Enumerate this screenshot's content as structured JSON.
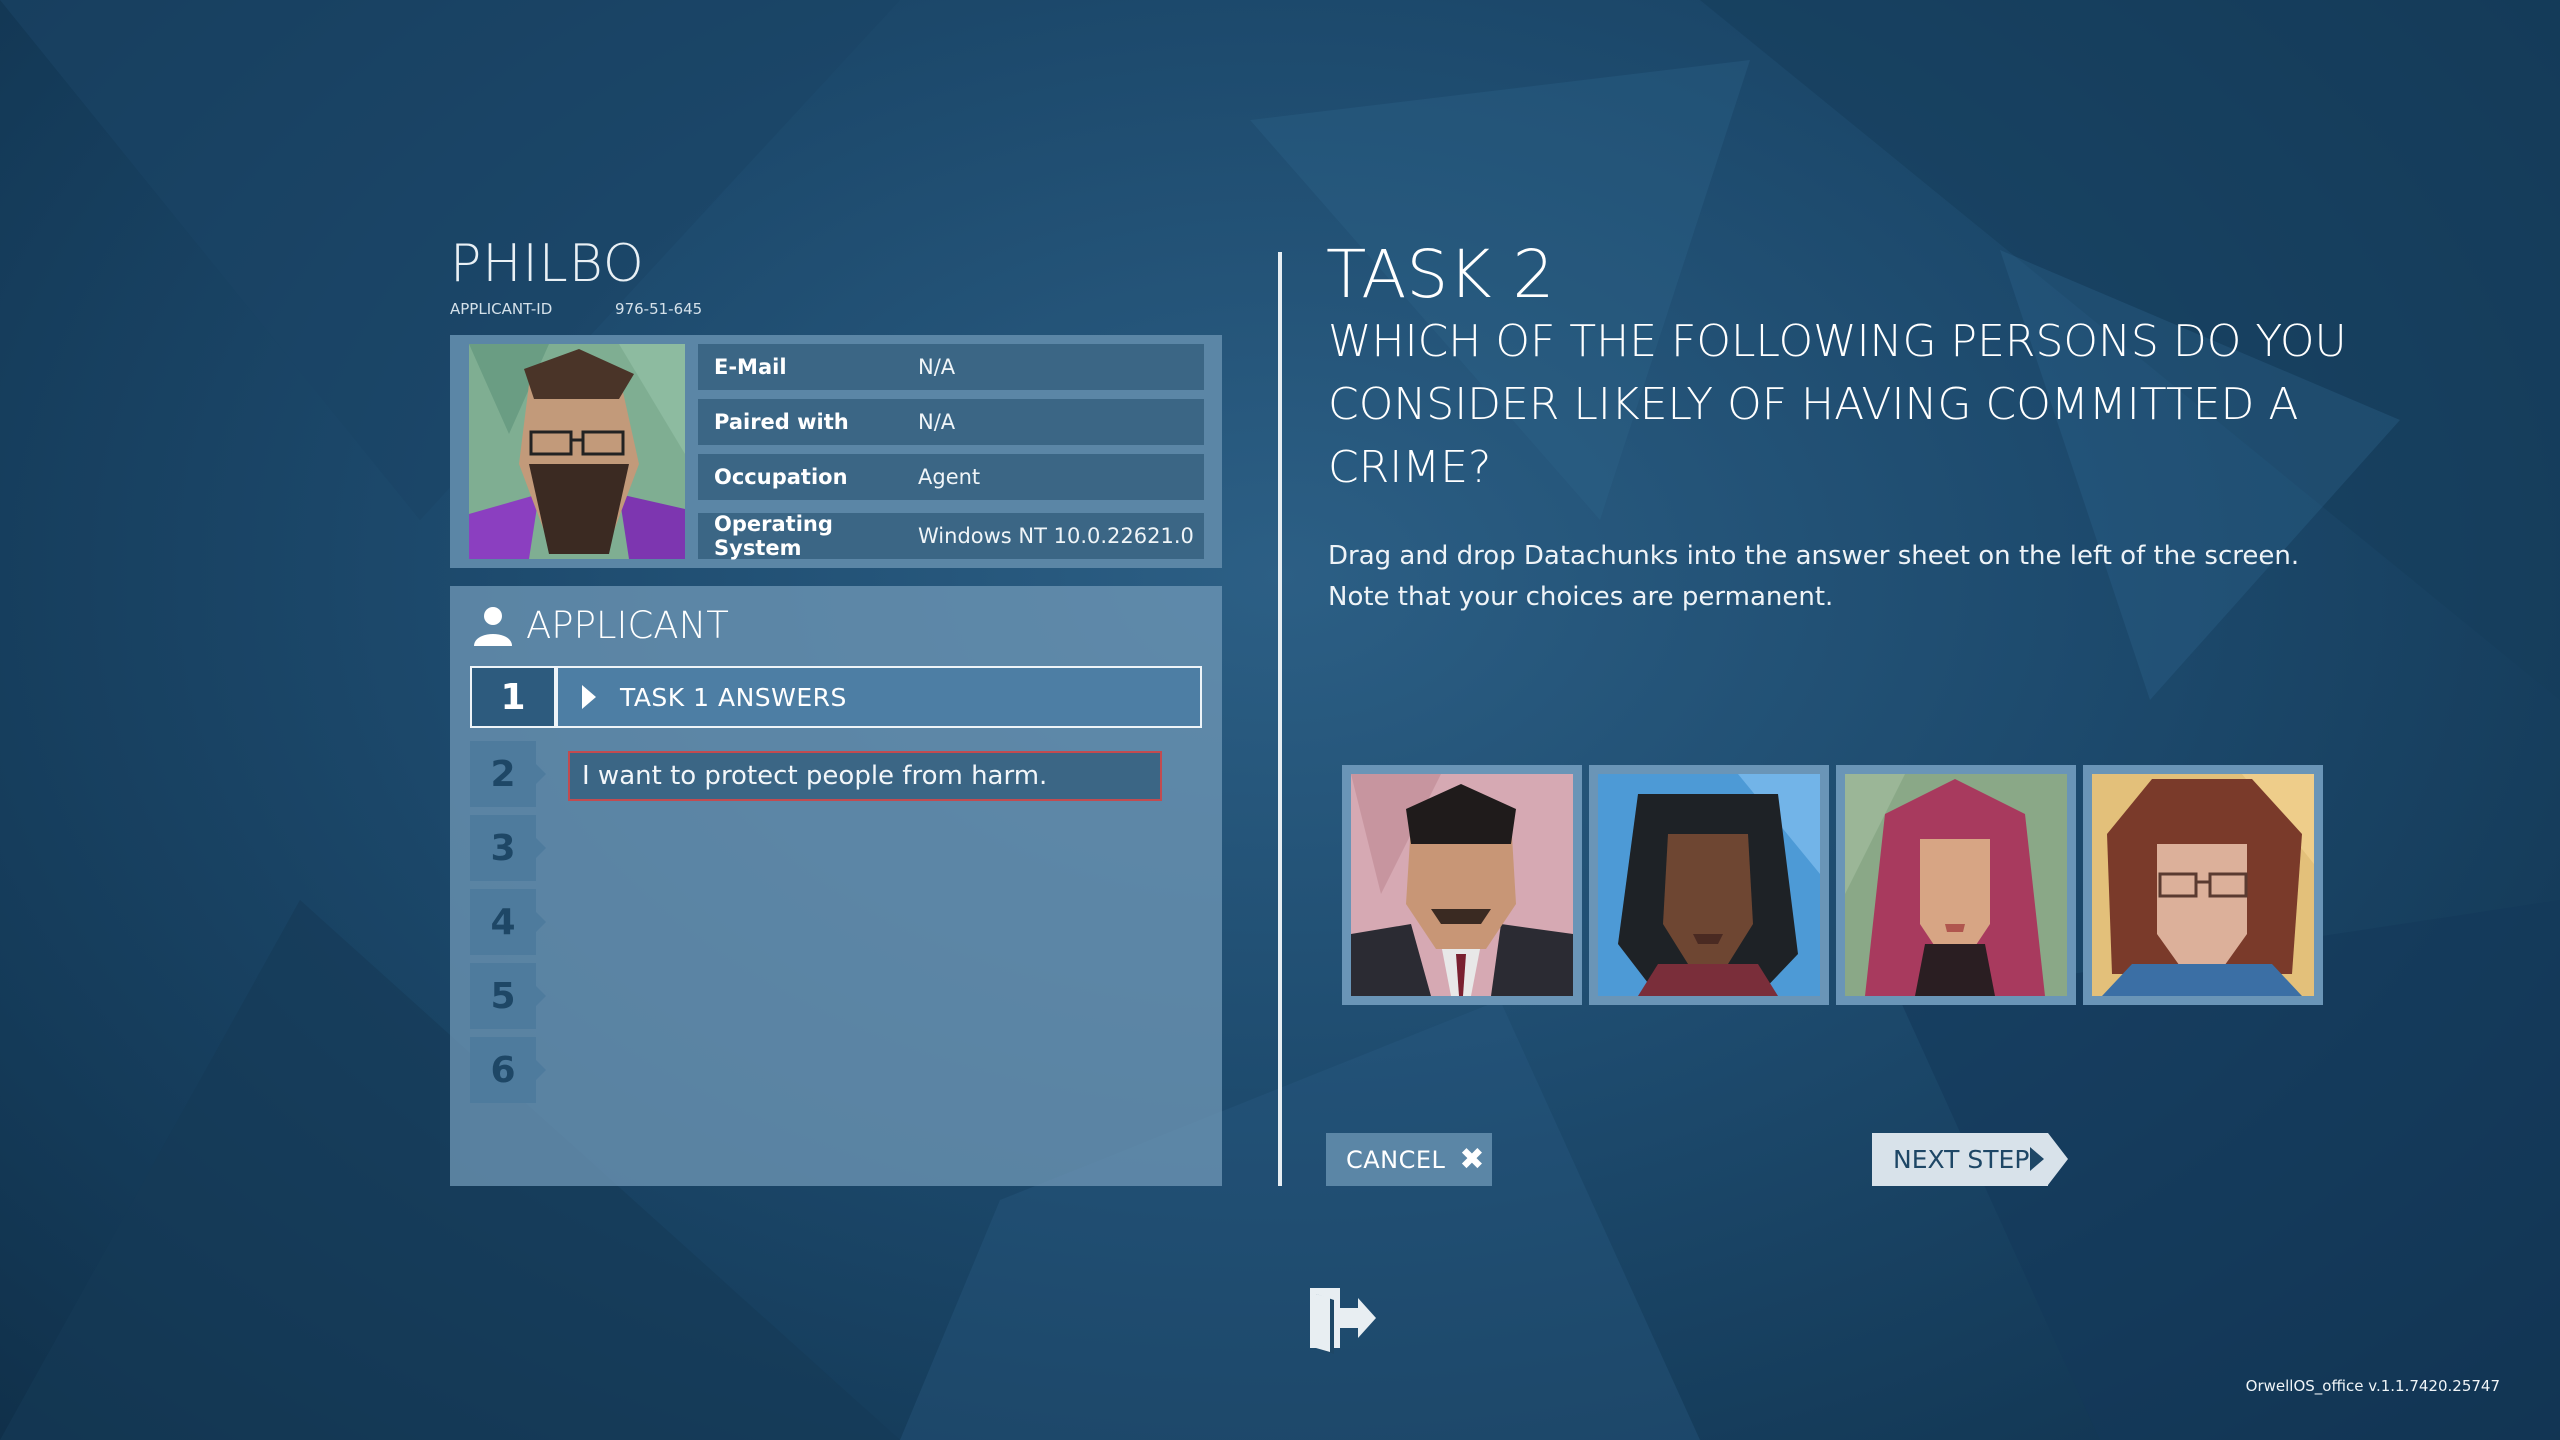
{
  "applicant": {
    "name": "PHILBO",
    "id_label": "APPLICANT-ID",
    "id_value": "976-51-645",
    "fields": [
      {
        "label": "E-Mail",
        "value": "N/A"
      },
      {
        "label": "Paired with",
        "value": "N/A"
      },
      {
        "label": "Occupation",
        "value": "Agent"
      },
      {
        "label": "Operating System",
        "value": "Windows NT 10.0.22621.0"
      }
    ]
  },
  "answer_sheet": {
    "heading": "APPLICANT",
    "task1": {
      "number": "1",
      "label": "TASK 1 ANSWERS"
    },
    "slots": [
      "2",
      "3",
      "4",
      "5",
      "6"
    ],
    "placed_answer": "I want to protect people from harm."
  },
  "task": {
    "title": "TASK 2",
    "question": "WHICH OF THE FOLLOWING PERSONS DO YOU CONSIDER LIKELY OF HAVING COMMITTED A CRIME?",
    "instructions": "Drag and drop Datachunks into the answer sheet on the left of the screen. Note that your choices are permanent."
  },
  "datachunks": [
    {
      "icon": "portrait-man-suit-icon"
    },
    {
      "icon": "portrait-woman-dark-hair-icon"
    },
    {
      "icon": "portrait-woman-headscarf-icon"
    },
    {
      "icon": "portrait-curly-hair-glasses-icon"
    }
  ],
  "buttons": {
    "cancel": "CANCEL",
    "next": "NEXT STEP"
  },
  "footer": {
    "version": "OrwellOS_office v.1.1.7420.25747"
  },
  "colors": {
    "background": "#1d4a6d",
    "panel": "#5b86a6",
    "accent_error": "#c24b50"
  }
}
